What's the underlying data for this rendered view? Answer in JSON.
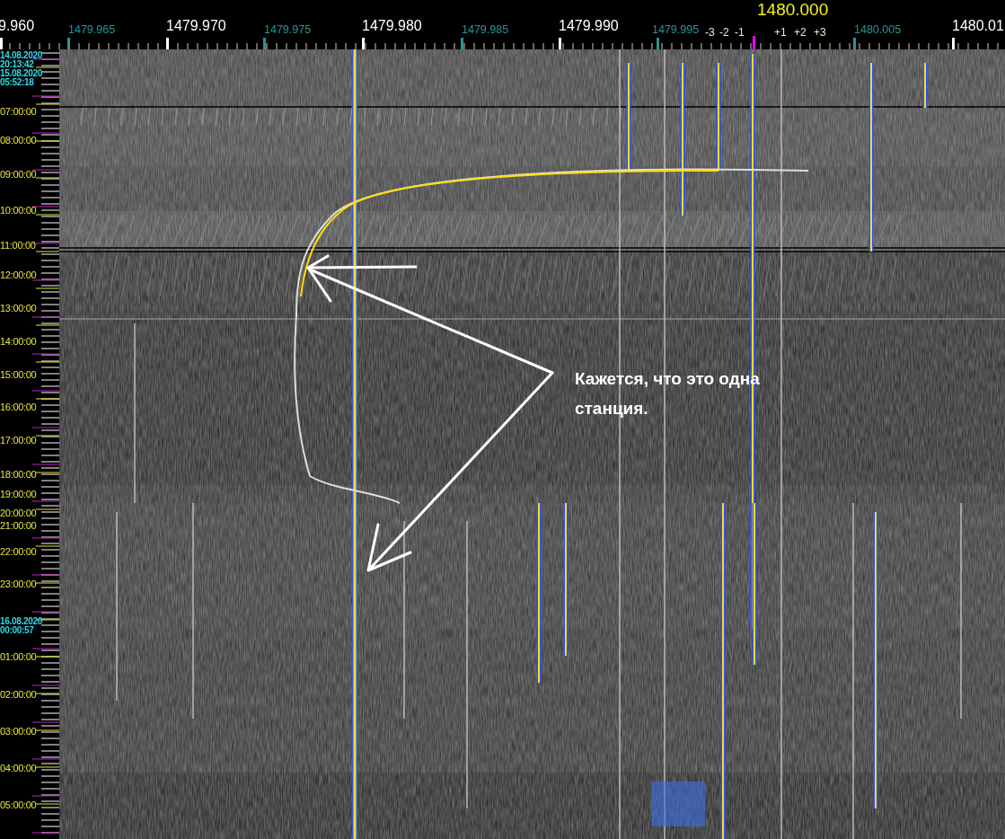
{
  "frequency_ruler": {
    "center_label": "1480.000",
    "labels": [
      {
        "text": "9.960",
        "kind": "major"
      },
      {
        "text": "1479.965",
        "kind": "minor"
      },
      {
        "text": "1479.970",
        "kind": "major"
      },
      {
        "text": "1479.975",
        "kind": "minor"
      },
      {
        "text": "1479.980",
        "kind": "major"
      },
      {
        "text": "1479.985",
        "kind": "minor"
      },
      {
        "text": "1479.990",
        "kind": "major"
      },
      {
        "text": "1479.995",
        "kind": "minor"
      },
      {
        "text": "1480.005",
        "kind": "minor"
      },
      {
        "text": "1480.01",
        "kind": "major"
      }
    ],
    "offsets": [
      "-3",
      "-2",
      "-1",
      "+1",
      "+2",
      "+3"
    ]
  },
  "time_axis": {
    "labels": [
      {
        "text": "14.08.2020",
        "kind": "date"
      },
      {
        "text": "20:13:42",
        "kind": "date"
      },
      {
        "text": "15.08.2020",
        "kind": "date"
      },
      {
        "text": "05:52:18",
        "kind": "date"
      },
      {
        "text": "07:00:00",
        "kind": "hour"
      },
      {
        "text": "08:00:00",
        "kind": "hour"
      },
      {
        "text": "09:00:00",
        "kind": "hour"
      },
      {
        "text": "10:00:00",
        "kind": "hour"
      },
      {
        "text": "11:00:00",
        "kind": "hour"
      },
      {
        "text": "12:00:00",
        "kind": "hour"
      },
      {
        "text": "13:00:00",
        "kind": "hour"
      },
      {
        "text": "14:00:00",
        "kind": "hour"
      },
      {
        "text": "15:00:00",
        "kind": "hour"
      },
      {
        "text": "16:00:00",
        "kind": "hour"
      },
      {
        "text": "17:00:00",
        "kind": "hour"
      },
      {
        "text": "18:00:00",
        "kind": "hour"
      },
      {
        "text": "19:00:00",
        "kind": "hour"
      },
      {
        "text": "20:00:00",
        "kind": "hour"
      },
      {
        "text": "21:00:00",
        "kind": "hour"
      },
      {
        "text": "22:00:00",
        "kind": "hour"
      },
      {
        "text": "23:00:00",
        "kind": "hour"
      },
      {
        "text": "16.08.2020",
        "kind": "date"
      },
      {
        "text": "00:00:57",
        "kind": "date"
      },
      {
        "text": "01:00:00",
        "kind": "hour"
      },
      {
        "text": "02:00:00",
        "kind": "hour"
      },
      {
        "text": "03:00:00",
        "kind": "hour"
      },
      {
        "text": "04:00:00",
        "kind": "hour"
      },
      {
        "text": "05:00:00",
        "kind": "hour"
      }
    ]
  },
  "annotation": {
    "text": "Кажется, что это одна станция."
  }
}
